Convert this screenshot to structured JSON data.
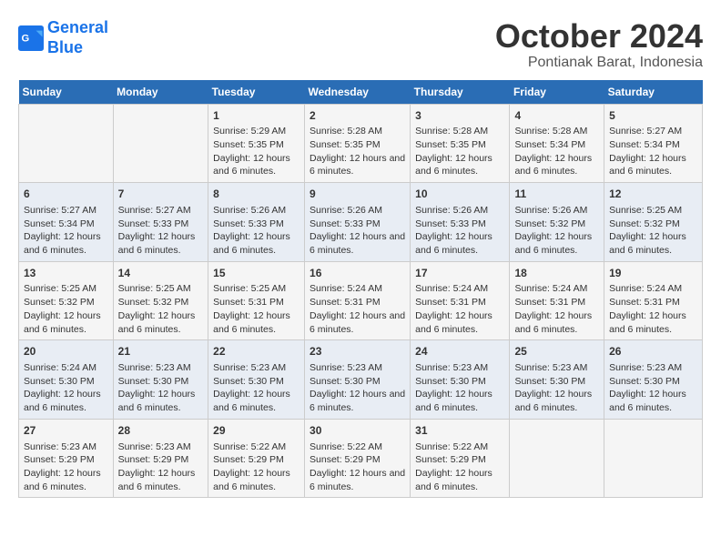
{
  "logo": {
    "line1": "General",
    "line2": "Blue"
  },
  "title": "October 2024",
  "location": "Pontianak Barat, Indonesia",
  "weekdays": [
    "Sunday",
    "Monday",
    "Tuesday",
    "Wednesday",
    "Thursday",
    "Friday",
    "Saturday"
  ],
  "weeks": [
    [
      {
        "day": "",
        "sunrise": "",
        "sunset": "",
        "daylight": ""
      },
      {
        "day": "",
        "sunrise": "",
        "sunset": "",
        "daylight": ""
      },
      {
        "day": "1",
        "sunrise": "Sunrise: 5:29 AM",
        "sunset": "Sunset: 5:35 PM",
        "daylight": "Daylight: 12 hours and 6 minutes."
      },
      {
        "day": "2",
        "sunrise": "Sunrise: 5:28 AM",
        "sunset": "Sunset: 5:35 PM",
        "daylight": "Daylight: 12 hours and 6 minutes."
      },
      {
        "day": "3",
        "sunrise": "Sunrise: 5:28 AM",
        "sunset": "Sunset: 5:35 PM",
        "daylight": "Daylight: 12 hours and 6 minutes."
      },
      {
        "day": "4",
        "sunrise": "Sunrise: 5:28 AM",
        "sunset": "Sunset: 5:34 PM",
        "daylight": "Daylight: 12 hours and 6 minutes."
      },
      {
        "day": "5",
        "sunrise": "Sunrise: 5:27 AM",
        "sunset": "Sunset: 5:34 PM",
        "daylight": "Daylight: 12 hours and 6 minutes."
      }
    ],
    [
      {
        "day": "6",
        "sunrise": "Sunrise: 5:27 AM",
        "sunset": "Sunset: 5:34 PM",
        "daylight": "Daylight: 12 hours and 6 minutes."
      },
      {
        "day": "7",
        "sunrise": "Sunrise: 5:27 AM",
        "sunset": "Sunset: 5:33 PM",
        "daylight": "Daylight: 12 hours and 6 minutes."
      },
      {
        "day": "8",
        "sunrise": "Sunrise: 5:26 AM",
        "sunset": "Sunset: 5:33 PM",
        "daylight": "Daylight: 12 hours and 6 minutes."
      },
      {
        "day": "9",
        "sunrise": "Sunrise: 5:26 AM",
        "sunset": "Sunset: 5:33 PM",
        "daylight": "Daylight: 12 hours and 6 minutes."
      },
      {
        "day": "10",
        "sunrise": "Sunrise: 5:26 AM",
        "sunset": "Sunset: 5:33 PM",
        "daylight": "Daylight: 12 hours and 6 minutes."
      },
      {
        "day": "11",
        "sunrise": "Sunrise: 5:26 AM",
        "sunset": "Sunset: 5:32 PM",
        "daylight": "Daylight: 12 hours and 6 minutes."
      },
      {
        "day": "12",
        "sunrise": "Sunrise: 5:25 AM",
        "sunset": "Sunset: 5:32 PM",
        "daylight": "Daylight: 12 hours and 6 minutes."
      }
    ],
    [
      {
        "day": "13",
        "sunrise": "Sunrise: 5:25 AM",
        "sunset": "Sunset: 5:32 PM",
        "daylight": "Daylight: 12 hours and 6 minutes."
      },
      {
        "day": "14",
        "sunrise": "Sunrise: 5:25 AM",
        "sunset": "Sunset: 5:32 PM",
        "daylight": "Daylight: 12 hours and 6 minutes."
      },
      {
        "day": "15",
        "sunrise": "Sunrise: 5:25 AM",
        "sunset": "Sunset: 5:31 PM",
        "daylight": "Daylight: 12 hours and 6 minutes."
      },
      {
        "day": "16",
        "sunrise": "Sunrise: 5:24 AM",
        "sunset": "Sunset: 5:31 PM",
        "daylight": "Daylight: 12 hours and 6 minutes."
      },
      {
        "day": "17",
        "sunrise": "Sunrise: 5:24 AM",
        "sunset": "Sunset: 5:31 PM",
        "daylight": "Daylight: 12 hours and 6 minutes."
      },
      {
        "day": "18",
        "sunrise": "Sunrise: 5:24 AM",
        "sunset": "Sunset: 5:31 PM",
        "daylight": "Daylight: 12 hours and 6 minutes."
      },
      {
        "day": "19",
        "sunrise": "Sunrise: 5:24 AM",
        "sunset": "Sunset: 5:31 PM",
        "daylight": "Daylight: 12 hours and 6 minutes."
      }
    ],
    [
      {
        "day": "20",
        "sunrise": "Sunrise: 5:24 AM",
        "sunset": "Sunset: 5:30 PM",
        "daylight": "Daylight: 12 hours and 6 minutes."
      },
      {
        "day": "21",
        "sunrise": "Sunrise: 5:23 AM",
        "sunset": "Sunset: 5:30 PM",
        "daylight": "Daylight: 12 hours and 6 minutes."
      },
      {
        "day": "22",
        "sunrise": "Sunrise: 5:23 AM",
        "sunset": "Sunset: 5:30 PM",
        "daylight": "Daylight: 12 hours and 6 minutes."
      },
      {
        "day": "23",
        "sunrise": "Sunrise: 5:23 AM",
        "sunset": "Sunset: 5:30 PM",
        "daylight": "Daylight: 12 hours and 6 minutes."
      },
      {
        "day": "24",
        "sunrise": "Sunrise: 5:23 AM",
        "sunset": "Sunset: 5:30 PM",
        "daylight": "Daylight: 12 hours and 6 minutes."
      },
      {
        "day": "25",
        "sunrise": "Sunrise: 5:23 AM",
        "sunset": "Sunset: 5:30 PM",
        "daylight": "Daylight: 12 hours and 6 minutes."
      },
      {
        "day": "26",
        "sunrise": "Sunrise: 5:23 AM",
        "sunset": "Sunset: 5:30 PM",
        "daylight": "Daylight: 12 hours and 6 minutes."
      }
    ],
    [
      {
        "day": "27",
        "sunrise": "Sunrise: 5:23 AM",
        "sunset": "Sunset: 5:29 PM",
        "daylight": "Daylight: 12 hours and 6 minutes."
      },
      {
        "day": "28",
        "sunrise": "Sunrise: 5:23 AM",
        "sunset": "Sunset: 5:29 PM",
        "daylight": "Daylight: 12 hours and 6 minutes."
      },
      {
        "day": "29",
        "sunrise": "Sunrise: 5:22 AM",
        "sunset": "Sunset: 5:29 PM",
        "daylight": "Daylight: 12 hours and 6 minutes."
      },
      {
        "day": "30",
        "sunrise": "Sunrise: 5:22 AM",
        "sunset": "Sunset: 5:29 PM",
        "daylight": "Daylight: 12 hours and 6 minutes."
      },
      {
        "day": "31",
        "sunrise": "Sunrise: 5:22 AM",
        "sunset": "Sunset: 5:29 PM",
        "daylight": "Daylight: 12 hours and 6 minutes."
      },
      {
        "day": "",
        "sunrise": "",
        "sunset": "",
        "daylight": ""
      },
      {
        "day": "",
        "sunrise": "",
        "sunset": "",
        "daylight": ""
      }
    ]
  ]
}
